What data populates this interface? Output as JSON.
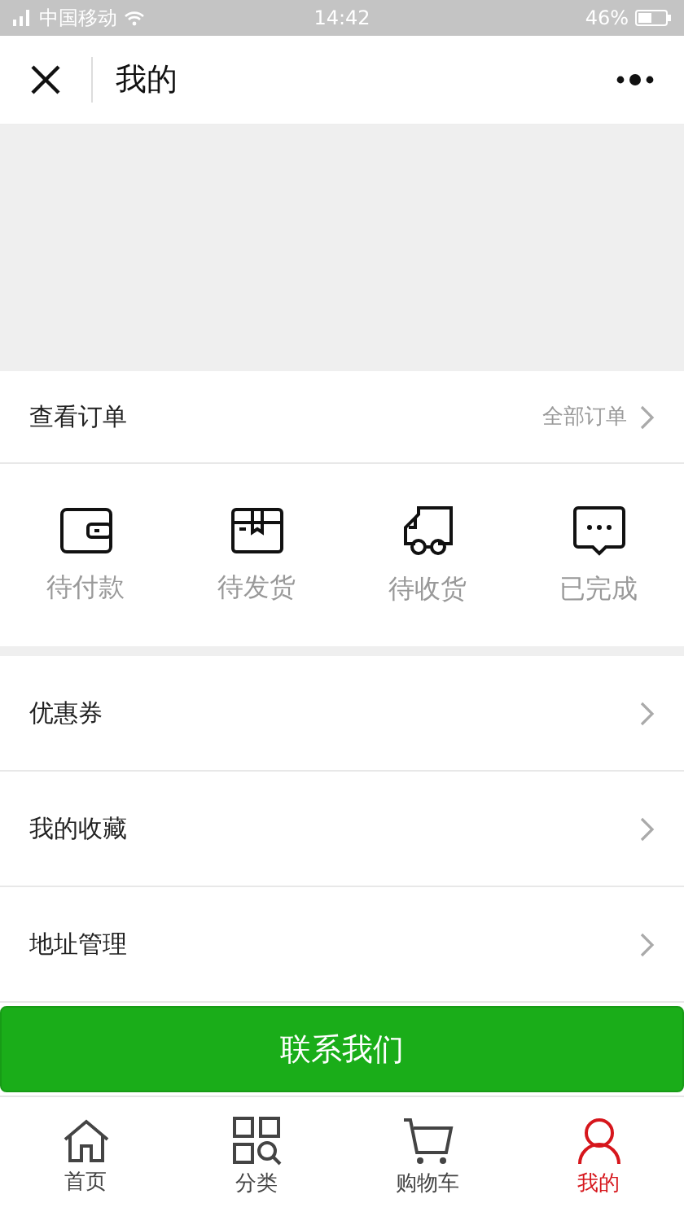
{
  "status_bar": {
    "carrier": "中国移动",
    "time": "14:42",
    "battery": "46%"
  },
  "header": {
    "title": "我的"
  },
  "orders": {
    "title": "查看订单",
    "link": "全部订单",
    "items": [
      {
        "kind": "wallet",
        "label": "待付款"
      },
      {
        "kind": "box",
        "label": "待发货"
      },
      {
        "kind": "truck",
        "label": "待收货"
      },
      {
        "kind": "chat",
        "label": "已完成"
      }
    ]
  },
  "menu": [
    "优惠券",
    "我的收藏",
    "地址管理"
  ],
  "contact_button": "联系我们",
  "tab_bar": [
    {
      "kind": "home",
      "label": "首页",
      "selected": false
    },
    {
      "kind": "category",
      "label": "分类",
      "selected": false
    },
    {
      "kind": "cart",
      "label": "购物车",
      "selected": false
    },
    {
      "kind": "user",
      "label": "我的",
      "selected": true
    }
  ]
}
